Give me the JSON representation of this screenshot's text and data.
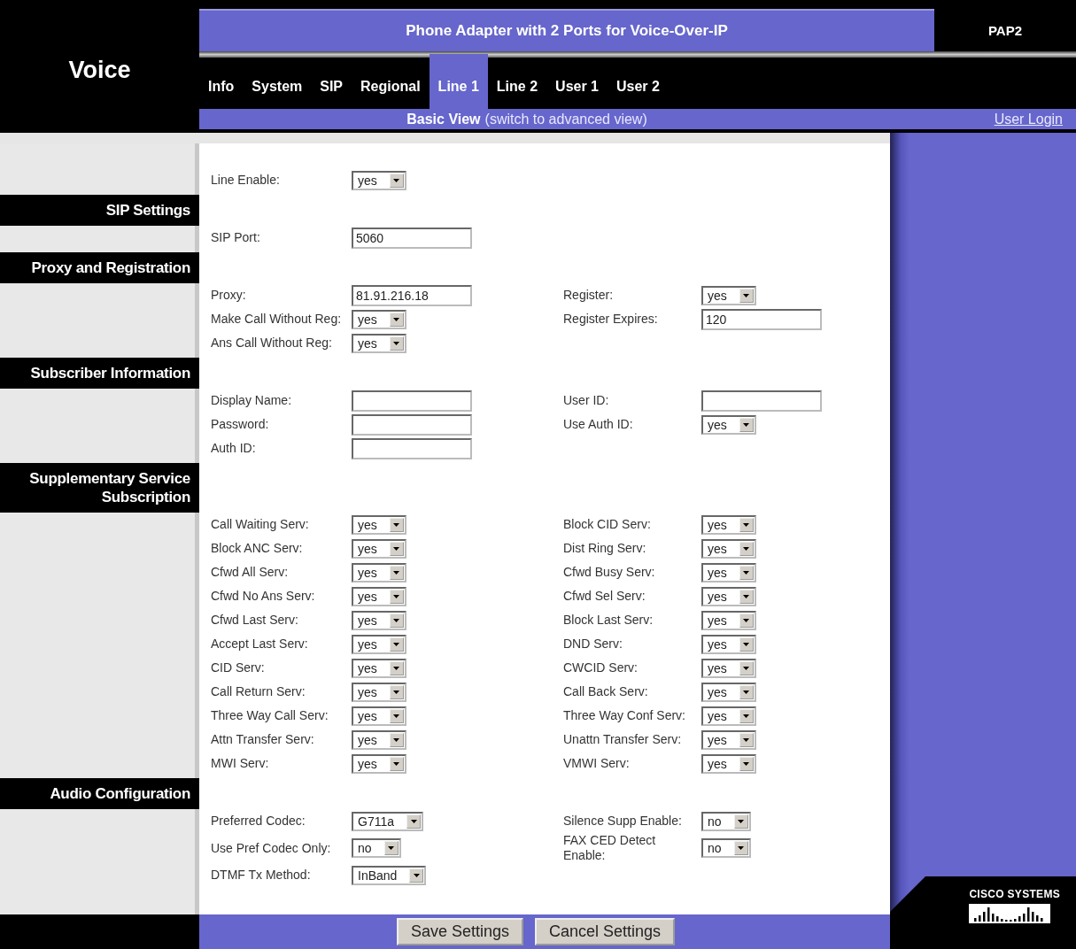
{
  "header": {
    "product": "Voice",
    "title": "Phone Adapter with 2 Ports for Voice-Over-IP",
    "model": "PAP2"
  },
  "tabs": [
    {
      "label": "Info",
      "selected": false
    },
    {
      "label": "System",
      "selected": false
    },
    {
      "label": "SIP",
      "selected": false
    },
    {
      "label": "Regional",
      "selected": false
    },
    {
      "label": "Line 1",
      "selected": true
    },
    {
      "label": "Line 2",
      "selected": false
    },
    {
      "label": "User 1",
      "selected": false
    },
    {
      "label": "User 2",
      "selected": false
    }
  ],
  "subbar": {
    "view": "Basic View",
    "switch_link": "(switch to advanced view)",
    "login": "User Login"
  },
  "blocks": [
    {
      "kind": "fields",
      "rows": [
        {
          "left": {
            "label": "Line Enable:",
            "kind": "select",
            "value": "yes"
          }
        }
      ]
    },
    {
      "kind": "heading",
      "title": "SIP Settings"
    },
    {
      "kind": "fields",
      "rows": [
        {
          "left": {
            "label": "SIP Port:",
            "kind": "text",
            "value": "5060"
          }
        }
      ]
    },
    {
      "kind": "heading",
      "title": "Proxy and Registration"
    },
    {
      "kind": "fields",
      "rows": [
        {
          "left": {
            "label": "Proxy:",
            "kind": "text",
            "value": "81.91.216.18"
          },
          "right": {
            "label": "Register:",
            "kind": "select",
            "value": "yes"
          }
        },
        {
          "left": {
            "label": "Make Call Without Reg:",
            "kind": "select",
            "value": "yes"
          },
          "right": {
            "label": "Register Expires:",
            "kind": "text",
            "value": "120"
          }
        },
        {
          "left": {
            "label": "Ans Call Without Reg:",
            "kind": "select",
            "value": "yes"
          }
        }
      ]
    },
    {
      "kind": "heading",
      "title": "Subscriber Information"
    },
    {
      "kind": "fields",
      "rows": [
        {
          "left": {
            "label": "Display Name:",
            "kind": "text"
          },
          "right": {
            "label": "User ID:",
            "kind": "text"
          }
        },
        {
          "left": {
            "label": "Password:",
            "kind": "text"
          },
          "right": {
            "label": "Use Auth ID:",
            "kind": "select",
            "value": "yes"
          }
        },
        {
          "left": {
            "label": "Auth ID:",
            "kind": "text"
          }
        }
      ]
    },
    {
      "kind": "heading",
      "title": "Supplementary Service Subscription"
    },
    {
      "kind": "fields",
      "rows": [
        {
          "left": {
            "label": "Call Waiting Serv:",
            "kind": "select",
            "value": "yes"
          },
          "right": {
            "label": "Block CID Serv:",
            "kind": "select",
            "value": "yes"
          }
        },
        {
          "left": {
            "label": "Block ANC Serv:",
            "kind": "select",
            "value": "yes"
          },
          "right": {
            "label": "Dist Ring Serv:",
            "kind": "select",
            "value": "yes"
          }
        },
        {
          "left": {
            "label": "Cfwd All Serv:",
            "kind": "select",
            "value": "yes"
          },
          "right": {
            "label": "Cfwd Busy Serv:",
            "kind": "select",
            "value": "yes"
          }
        },
        {
          "left": {
            "label": "Cfwd No Ans Serv:",
            "kind": "select",
            "value": "yes"
          },
          "right": {
            "label": "Cfwd Sel Serv:",
            "kind": "select",
            "value": "yes"
          }
        },
        {
          "left": {
            "label": "Cfwd Last Serv:",
            "kind": "select",
            "value": "yes"
          },
          "right": {
            "label": "Block Last Serv:",
            "kind": "select",
            "value": "yes"
          }
        },
        {
          "left": {
            "label": "Accept Last Serv:",
            "kind": "select",
            "value": "yes"
          },
          "right": {
            "label": "DND Serv:",
            "kind": "select",
            "value": "yes"
          }
        },
        {
          "left": {
            "label": "CID Serv:",
            "kind": "select",
            "value": "yes"
          },
          "right": {
            "label": "CWCID Serv:",
            "kind": "select",
            "value": "yes"
          }
        },
        {
          "left": {
            "label": "Call Return Serv:",
            "kind": "select",
            "value": "yes"
          },
          "right": {
            "label": "Call Back Serv:",
            "kind": "select",
            "value": "yes"
          }
        },
        {
          "left": {
            "label": "Three Way Call Serv:",
            "kind": "select",
            "value": "yes"
          },
          "right": {
            "label": "Three Way Conf Serv:",
            "kind": "select",
            "value": "yes"
          }
        },
        {
          "left": {
            "label": "Attn Transfer Serv:",
            "kind": "select",
            "value": "yes"
          },
          "right": {
            "label": "Unattn Transfer Serv:",
            "kind": "select",
            "value": "yes"
          }
        },
        {
          "left": {
            "label": "MWI Serv:",
            "kind": "select",
            "value": "yes"
          },
          "right": {
            "label": "VMWI Serv:",
            "kind": "select",
            "value": "yes"
          }
        }
      ]
    },
    {
      "kind": "heading",
      "title": "Audio Configuration"
    },
    {
      "kind": "fields",
      "rows": [
        {
          "left": {
            "label": "Preferred Codec:",
            "kind": "select",
            "value": "G711a"
          },
          "right": {
            "label": "Silence Supp Enable:",
            "kind": "select",
            "value": "no"
          }
        },
        {
          "left": {
            "label": "Use Pref Codec Only:",
            "kind": "select",
            "value": "no"
          },
          "right": {
            "label": "FAX CED Detect Enable:",
            "kind": "select",
            "value": "no"
          }
        },
        {
          "left": {
            "label": "DTMF Tx Method:",
            "kind": "select",
            "value": "InBand"
          }
        }
      ]
    }
  ],
  "buttons": [
    "Save Settings",
    "Cancel Settings"
  ],
  "logo": {
    "text": "CISCO SYSTEMS"
  }
}
